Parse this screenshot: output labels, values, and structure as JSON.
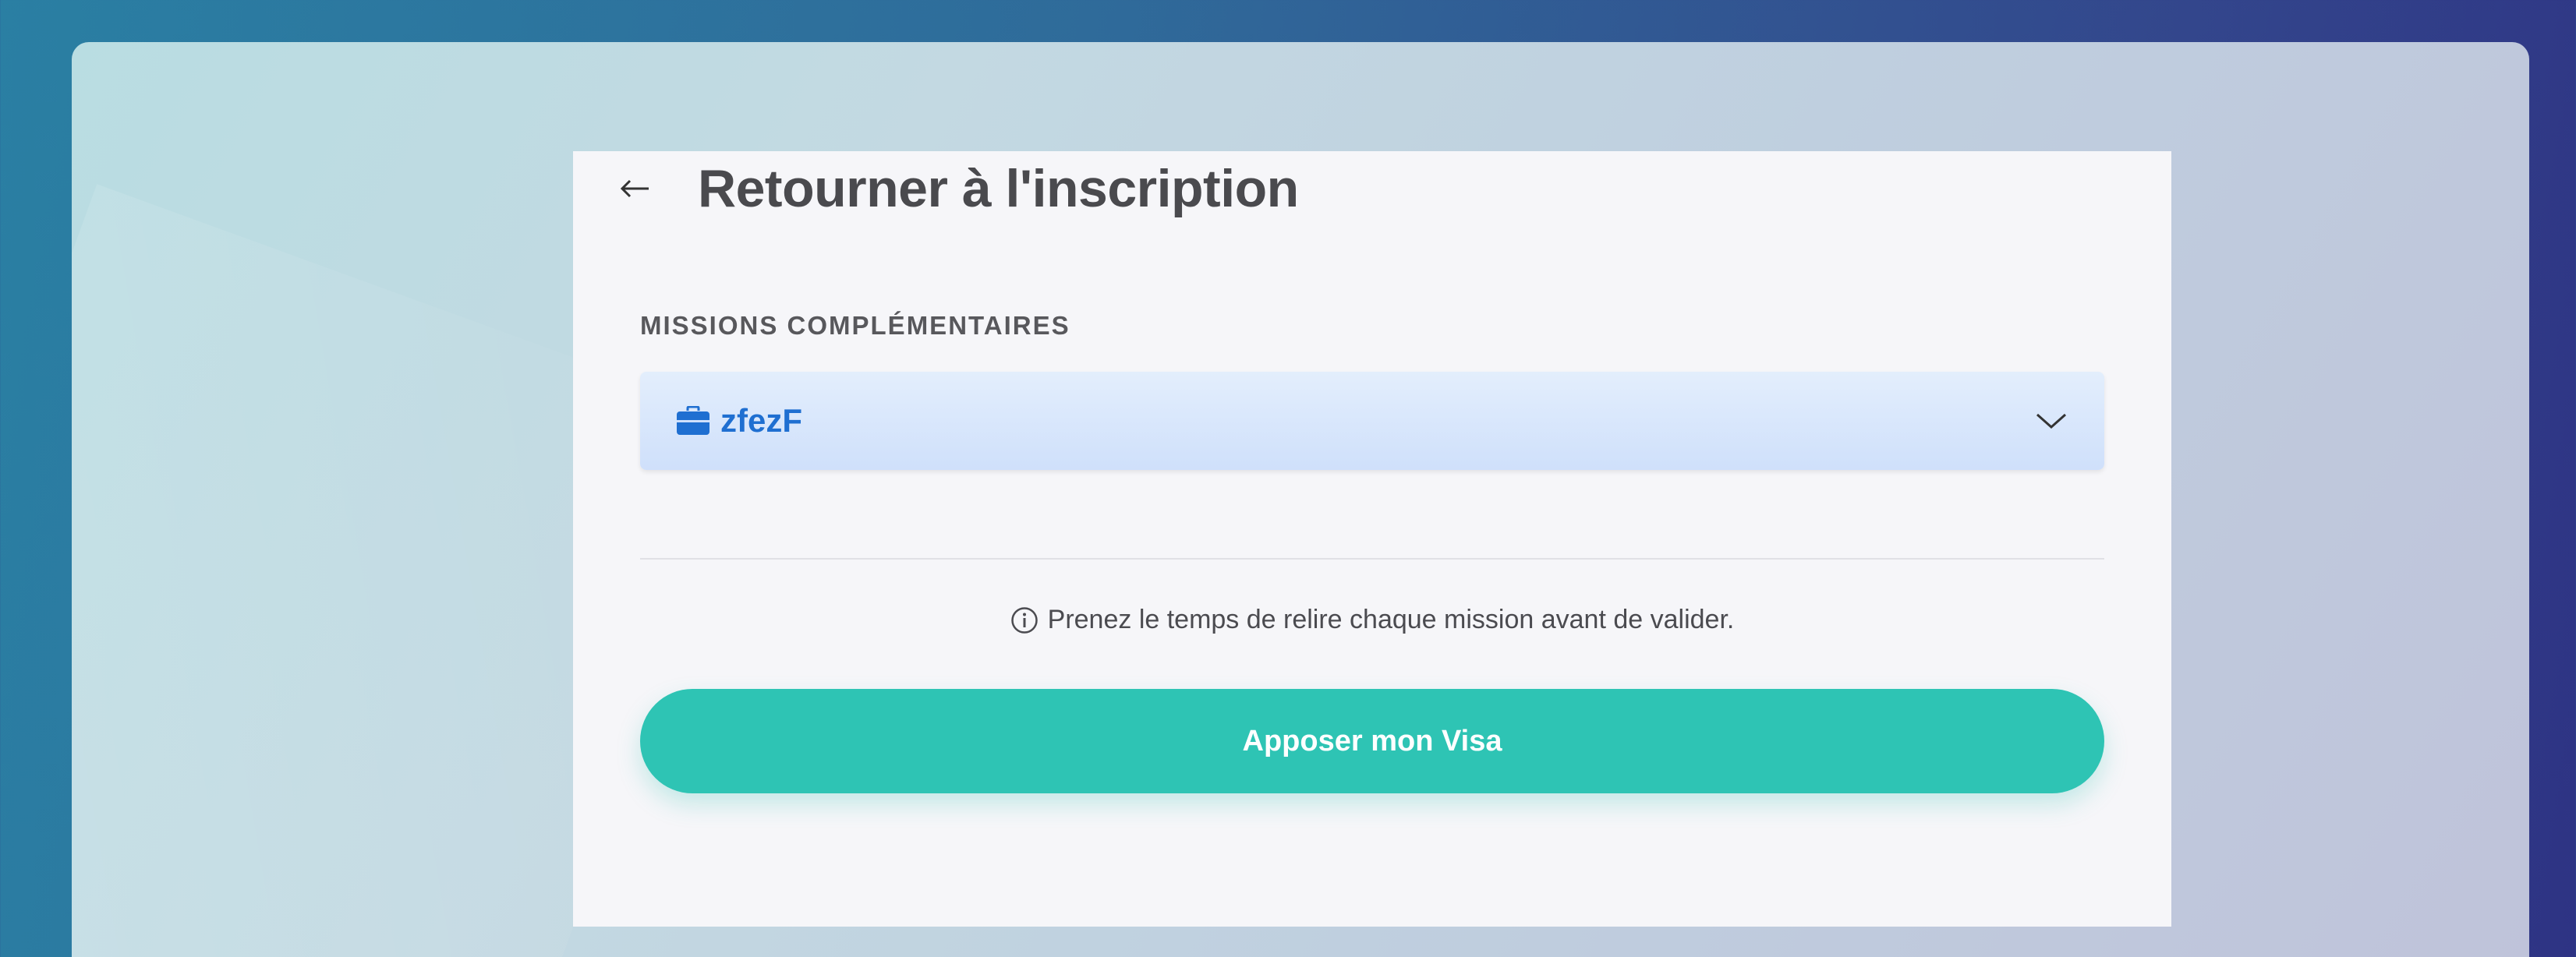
{
  "header": {
    "back_icon": "arrow-left-icon",
    "title": "Retourner à l'inscription"
  },
  "missions": {
    "section_label": "MISSIONS COMPLÉMENTAIRES",
    "selected_icon": "briefcase-icon",
    "selected_value": "zfezF",
    "expand_icon": "chevron-down-icon"
  },
  "info": {
    "icon": "info-icon",
    "text": "Prenez le temps de relire chaque mission avant de valider."
  },
  "actions": {
    "submit_label": "Apposer mon Visa"
  },
  "colors": {
    "accent": "#2ec4b4",
    "link_blue": "#1f6fd1",
    "title_text": "#4a4a4e",
    "card_bg": "#f6f6f9"
  }
}
